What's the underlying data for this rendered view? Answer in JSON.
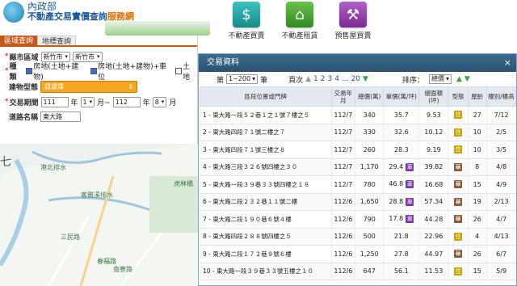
{
  "header": {
    "ministry": "內政部",
    "site_name_main": "不動產交易實價查詢",
    "site_name_hl": "服務網",
    "nav": [
      {
        "label": "不動產買賣",
        "icon": "house-dollar-icon"
      },
      {
        "label": "不動產租賃",
        "icon": "house-rent-icon"
      },
      {
        "label": "預售屋買賣",
        "icon": "crane-building-icon"
      }
    ]
  },
  "search": {
    "tabs": [
      "區域查詢",
      "地標查詢"
    ],
    "county_label": "縣市區域",
    "county_value": "新竹市",
    "district_value": "新竹市",
    "type_label": "種類",
    "type_opt1": "房地(土地+建物)",
    "type_opt2": "房地(土地+建物)+車位",
    "type_opt3": "土地",
    "bldg_label": "建物型態",
    "bldg_value": "請選擇",
    "period_label": "交易期間",
    "year_from": "111",
    "year_unit": "年",
    "month_from": "1",
    "month_unit_tilde": "月~",
    "year_to": "112",
    "month_to": "8",
    "month_unit": "月",
    "road_label": "道路名稱",
    "road_value": "東大路"
  },
  "map": {
    "labels": [
      "港北排水",
      "客雅溪排水",
      "三民路",
      "春福路",
      "南寮路",
      "虎林橋",
      "七"
    ]
  },
  "modal": {
    "title": "交易資料",
    "close": "×",
    "page_prefix": "第",
    "page_range": "1~200",
    "page_suffix": "筆",
    "page_label": "頁次",
    "pages": [
      "1",
      "2",
      "3",
      "4",
      "...",
      "20"
    ],
    "sort_label": "排序：",
    "sort_value": "總價",
    "columns": [
      "區段位置或門牌",
      "交易年月",
      "總價(萬)",
      "單價(萬/坪)",
      "總面積(坪)",
      "型態",
      "屋齡",
      "樓別/樓高"
    ],
    "rows": [
      {
        "addr": "1 - 東大路一段５２巷１之１號７樓之５",
        "ym": "112/7",
        "total": "340",
        "unit": "35.7",
        "park": "",
        "area": "9.53",
        "type": "住",
        "age": "27",
        "floor": "7/12"
      },
      {
        "addr": "2 - 東大路四段７１號二樓之７",
        "ym": "112/7",
        "total": "330",
        "unit": "32.6",
        "park": "",
        "area": "10.12",
        "type": "住",
        "age": "10",
        "floor": "2/5"
      },
      {
        "addr": "3 - 東大路四段７１號三樓之８",
        "ym": "112/7",
        "total": "260",
        "unit": "28.3",
        "park": "",
        "area": "9.19",
        "type": "住",
        "age": "10",
        "floor": "3/5"
      },
      {
        "addr": "4 - 東大路三段３２６號四樓之３０",
        "ym": "112/7",
        "total": "1,170",
        "unit": "29.4",
        "park": "車",
        "area": "39.82",
        "type": "華",
        "age": "8",
        "floor": "4/8"
      },
      {
        "addr": "5 - 東大路一段３９巷３３號四樓之１８",
        "ym": "112/7",
        "total": "780",
        "unit": "46.8",
        "park": "車",
        "area": "16.68",
        "type": "華",
        "age": "15",
        "floor": "4/9"
      },
      {
        "addr": "6 - 東大路二段２３２巷１１號二樓",
        "ym": "112/6",
        "total": "1,650",
        "unit": "28.8",
        "park": "車",
        "area": "57.34",
        "type": "華",
        "age": "19",
        "floor": "2/13"
      },
      {
        "addr": "7 - 東大路二段１９０巷６號４樓",
        "ym": "112/6",
        "total": "790",
        "unit": "17.8",
        "park": "車",
        "area": "44.28",
        "type": "華",
        "age": "26",
        "floor": "4/7"
      },
      {
        "addr": "8 - 東大路四段２８８號四樓之５",
        "ym": "112/6",
        "total": "500",
        "unit": "21.8",
        "park": "",
        "area": "22.96",
        "type": "住",
        "age": "4",
        "floor": "4/13"
      },
      {
        "addr": "9 - 東大路二段１７２巷９號６樓",
        "ym": "112/6",
        "total": "1,250",
        "unit": "27.8",
        "park": "",
        "area": "44.97",
        "type": "華",
        "age": "26",
        "floor": "6/7"
      },
      {
        "addr": "10 - 東大路一段３９巷３３號五樓之１０",
        "ym": "112/6",
        "total": "647",
        "unit": "56.1",
        "park": "",
        "area": "11.53",
        "type": "住",
        "age": "15",
        "floor": "5/9"
      }
    ]
  }
}
